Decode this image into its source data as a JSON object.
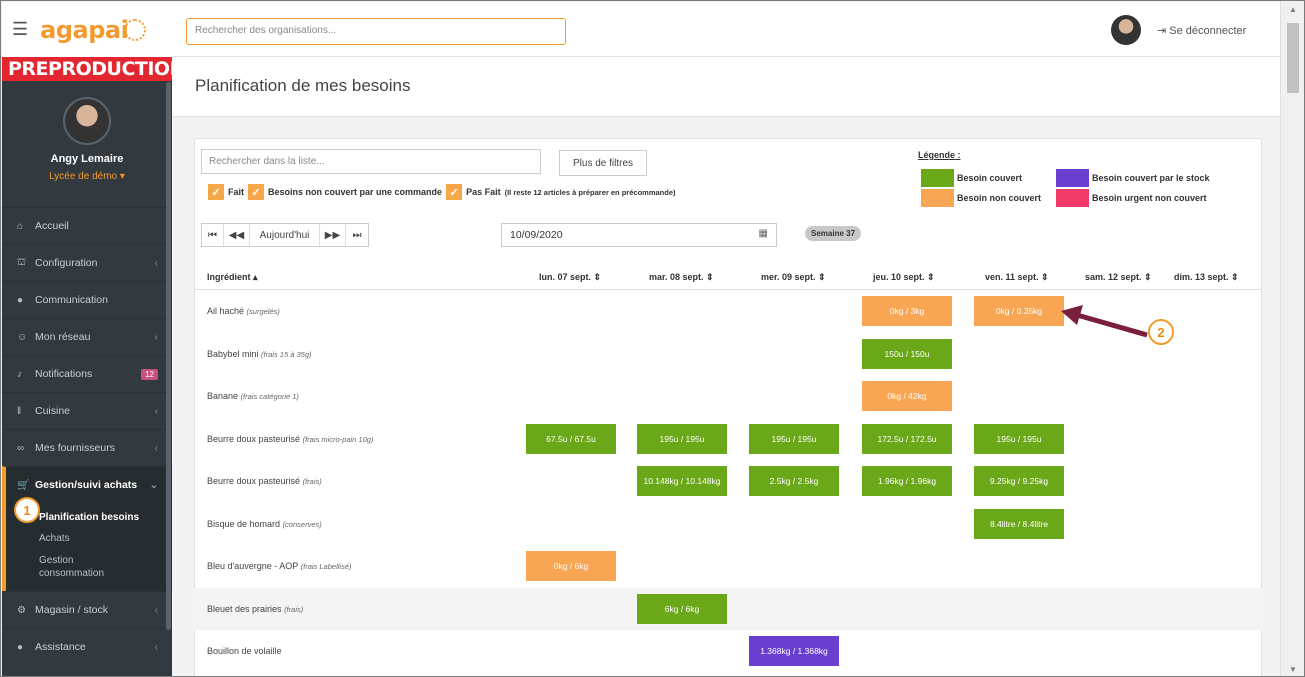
{
  "app": {
    "logo": "agapai",
    "env_banner": "PREPRODUCTION"
  },
  "profile": {
    "name": "Angy Lemaire",
    "school": "Lycée de démo ▾"
  },
  "sidebar": {
    "items": [
      {
        "icon": "home-icon",
        "glyph": "⌂",
        "label": "Accueil",
        "chevron": ""
      },
      {
        "icon": "bank-icon",
        "glyph": "⛫",
        "label": "Configuration",
        "chevron": "‹"
      },
      {
        "icon": "chat-icon",
        "glyph": "●",
        "label": "Communication",
        "chevron": ""
      },
      {
        "icon": "users-icon",
        "glyph": "☺",
        "label": "Mon réseau",
        "chevron": "‹"
      },
      {
        "icon": "bell-icon",
        "glyph": "♪",
        "label": "Notifications",
        "badge": "12"
      },
      {
        "icon": "cutlery-icon",
        "glyph": "‖",
        "label": "Cuisine",
        "chevron": "‹"
      },
      {
        "icon": "handshake-icon",
        "glyph": "∞",
        "label": "Mes fournisseurs",
        "chevron": "‹"
      }
    ],
    "active_section": {
      "label": "Gestion/suivi achats",
      "glyph": "🛒",
      "chevron": "⌄"
    },
    "subitems": [
      "Planification besoins",
      "Achats",
      "Gestion consommation"
    ],
    "bottom_items": [
      {
        "glyph": "⚙",
        "label": "Magasin / stock",
        "chevron": "‹"
      },
      {
        "glyph": "●",
        "label": "Assistance",
        "chevron": "‹"
      }
    ]
  },
  "header": {
    "org_search_placeholder": "Rechercher des organisations...",
    "logout_icon": "⇥",
    "logout_label": "Se déconnecter"
  },
  "page": {
    "title": "Planification de mes besoins",
    "list_search_placeholder": "Rechercher dans la liste...",
    "more_filters": "Plus de filtres",
    "filters": [
      {
        "label": "Fait",
        "checked": true
      },
      {
        "label": "Besoins non couvert par une commande",
        "checked": true
      },
      {
        "label": "Pas Fait",
        "checked": true,
        "note": "(Il reste 12 articles à préparer en précommande)"
      }
    ],
    "legend": {
      "title": "Légende :",
      "items": [
        {
          "label": "Besoin couvert",
          "color": "#6aa81a"
        },
        {
          "label": "Besoin couvert par le stock",
          "color": "#6a3fd0"
        },
        {
          "label": "Besoin non couvert",
          "color": "#f8a653"
        },
        {
          "label": "Besoin urgent non couvert",
          "color": "#f23a6a"
        }
      ]
    },
    "nav": {
      "first": "⏮",
      "prev": "◀◀",
      "today": "Aujourd'hui",
      "next": "▶▶",
      "last": "⏭"
    },
    "date": "10/09/2020",
    "week": "Semaine 37"
  },
  "table": {
    "ingredient_header": "Ingrédient ▴",
    "days": [
      "lun. 07 sept. ⇕",
      "mar. 08 sept. ⇕",
      "mer. 09 sept. ⇕",
      "jeu. 10 sept. ⇕",
      "ven. 11 sept. ⇕",
      "sam. 12 sept. ⇕",
      "dim. 13 sept. ⇕"
    ],
    "rows": [
      {
        "name": "Ail haché",
        "cat": "(surgelés)",
        "cells": [
          null,
          null,
          null,
          {
            "text": "0kg / 3kg",
            "status": "uncovered"
          },
          {
            "text": "0kg / 0.35kg",
            "status": "uncovered"
          },
          null,
          null
        ]
      },
      {
        "name": "Babybel mini",
        "cat": "(frais 15 à 35g)",
        "cells": [
          null,
          null,
          null,
          {
            "text": "150u / 150u",
            "status": "covered"
          },
          null,
          null,
          null
        ]
      },
      {
        "name": "Banane",
        "cat": "(frais catégorie 1)",
        "cells": [
          null,
          null,
          null,
          {
            "text": "0kg / 42kg",
            "status": "uncovered"
          },
          null,
          null,
          null
        ]
      },
      {
        "name": "Beurre doux pasteurisé",
        "cat": "(frais micro-pain 10g)",
        "cells": [
          {
            "text": "67.5u / 67.5u",
            "status": "covered"
          },
          {
            "text": "195u / 195u",
            "status": "covered"
          },
          {
            "text": "195u / 195u",
            "status": "covered"
          },
          {
            "text": "172.5u / 172.5u",
            "status": "covered"
          },
          {
            "text": "195u / 195u",
            "status": "covered"
          },
          null,
          null
        ]
      },
      {
        "name": "Beurre doux pasteurisé",
        "cat": "(frais)",
        "cells": [
          null,
          {
            "text": "10.148kg / 10.148kg",
            "status": "covered"
          },
          {
            "text": "2.5kg / 2.5kg",
            "status": "covered"
          },
          {
            "text": "1.96kg / 1.96kg",
            "status": "covered"
          },
          {
            "text": "9.25kg / 9.25kg",
            "status": "covered"
          },
          null,
          null
        ]
      },
      {
        "name": "Bisque de homard",
        "cat": "(conserves)",
        "cells": [
          null,
          null,
          null,
          null,
          {
            "text": "8.4litre / 8.4litre",
            "status": "covered"
          },
          null,
          null
        ]
      },
      {
        "name": "Bleu d'auvergne - AOP",
        "cat": "(frais Labellisé)",
        "cells": [
          {
            "text": "0kg / 6kg",
            "status": "uncovered"
          },
          null,
          null,
          null,
          null,
          null,
          null
        ]
      },
      {
        "name": "Bleuet des prairies",
        "cat": "(frais)",
        "cells": [
          null,
          {
            "text": "6kg / 6kg",
            "status": "covered"
          },
          null,
          null,
          null,
          null,
          null
        ]
      },
      {
        "name": "Bouillon de volaille",
        "cat": "",
        "cells": [
          null,
          null,
          {
            "text": "1.368kg / 1.368kg",
            "status": "stock"
          },
          null,
          null,
          null,
          null
        ]
      }
    ]
  },
  "annotations": {
    "step1": "1",
    "step2": "2"
  },
  "colors": {
    "covered": "#6aa81a",
    "uncovered": "#f8a653",
    "stock": "#6a3fd0",
    "urgent": "#f23a6a",
    "accent": "#f29a2e",
    "arrow": "#7a1e3c"
  }
}
